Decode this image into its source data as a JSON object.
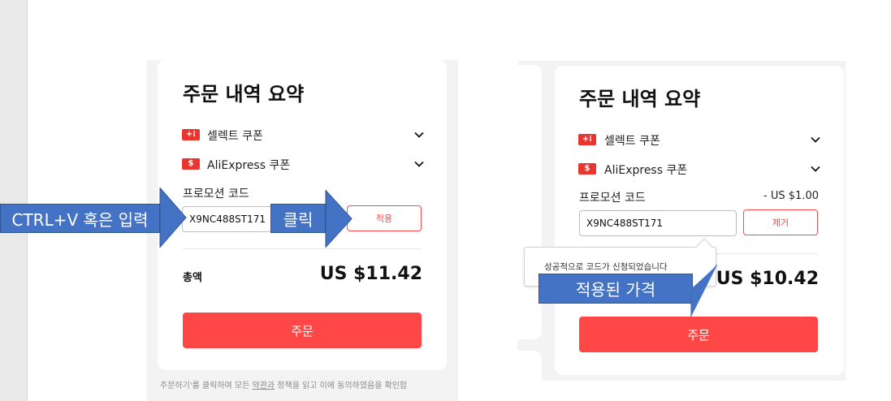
{
  "left_panel": {
    "title": "주문 내역 요약",
    "coupons": [
      {
        "icon": "select-coupon-icon",
        "icon_glyph": "+⁞",
        "label": "셀렉트 쿠폰"
      },
      {
        "icon": "aliexpress-coupon-icon",
        "icon_glyph": "$",
        "label": "AliExpress 쿠폰"
      }
    ],
    "promo_label": "프로모션 코드",
    "promo_value": "X9NC488ST171",
    "apply_button": "적용",
    "total_label": "총액",
    "total_value": "US $11.42",
    "order_button": "주문",
    "footnote_prefix": "주문하기'를 클릭하여 모든 ",
    "footnote_link1": "약관과",
    "footnote_middle": " 정책을 읽고 이에 동의하였음을 확인합"
  },
  "right_panel": {
    "title": "주문 내역 요약",
    "coupons": [
      {
        "icon": "select-coupon-icon",
        "icon_glyph": "+⁞",
        "label": "셀렉트 쿠폰"
      },
      {
        "icon": "aliexpress-coupon-icon",
        "icon_glyph": "$",
        "label": "AliExpress 쿠폰"
      }
    ],
    "promo_label": "프로모션 코드",
    "discount": "- US $1.00",
    "promo_value": "X9NC488ST171",
    "remove_button": "제거",
    "tooltip": "성공적으로 코드가 신청되었습니다",
    "total_value": "US $10.42",
    "order_button": "주문"
  },
  "annotations": {
    "paste_label": "CTRL+V 혹은 입력",
    "click_label": "클릭",
    "applied_label": "적용된 가격"
  },
  "colors": {
    "accent": "#ff4747",
    "annotation_blue": "#4472c4"
  }
}
